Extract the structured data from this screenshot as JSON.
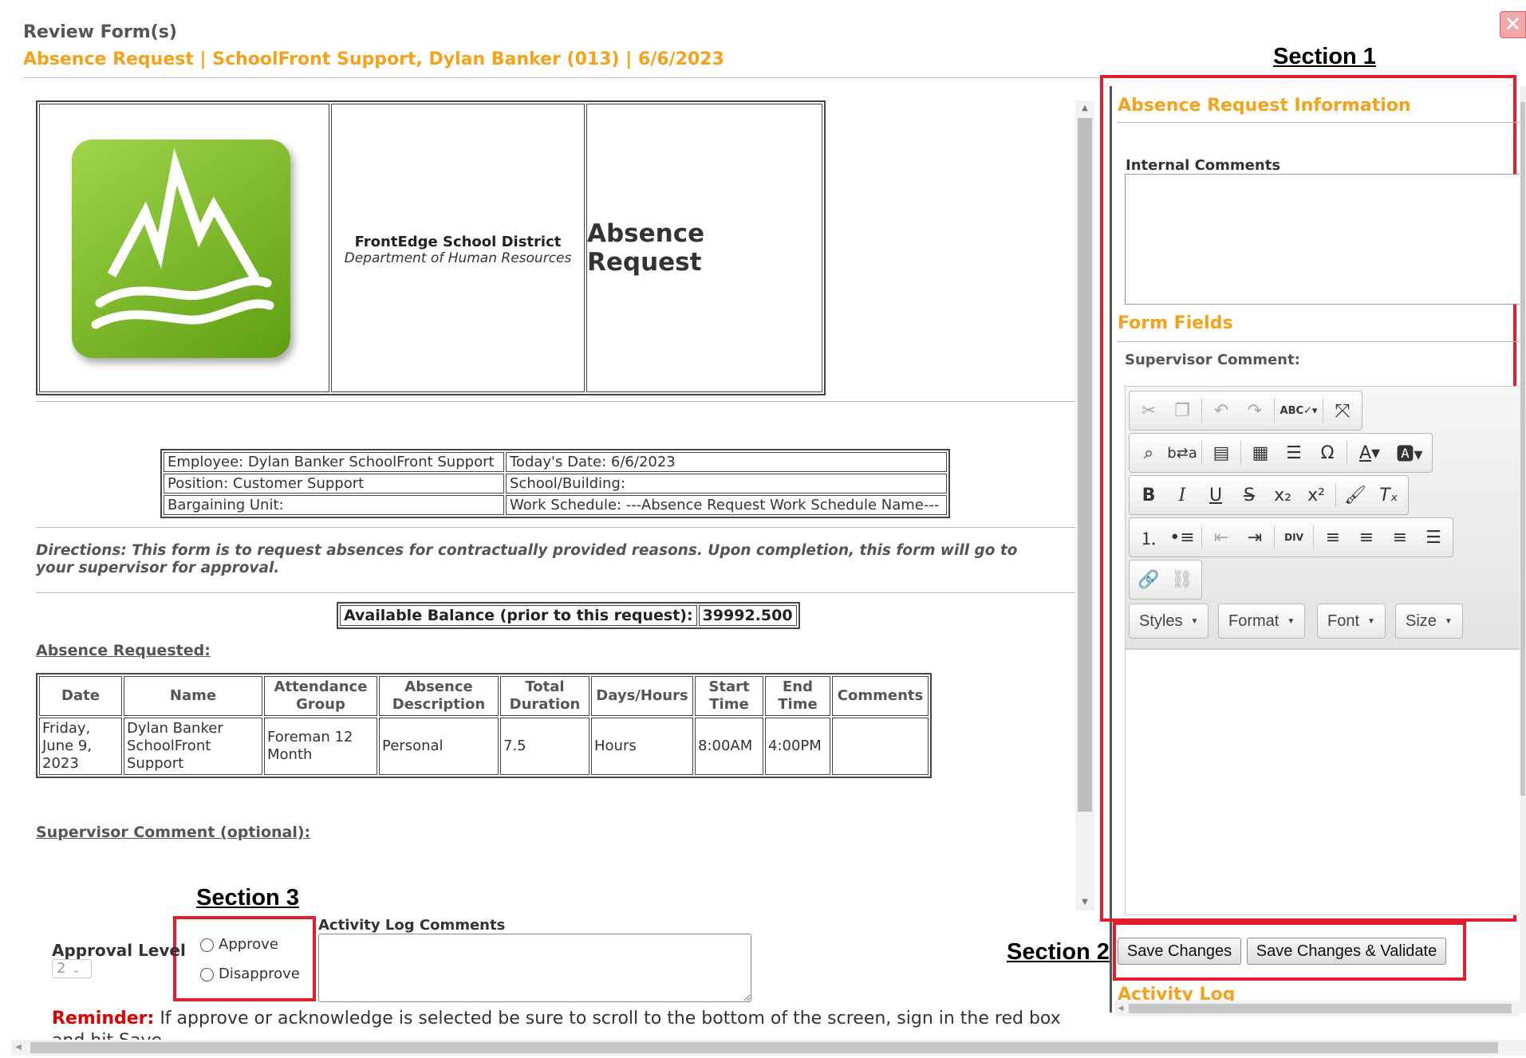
{
  "dialog": {
    "title": "Review Form(s)",
    "subtitle": "Absence Request | SchoolFront Support, Dylan Banker (013) | 6/6/2023"
  },
  "annotations": {
    "section1": "Section 1",
    "section2": "Section 2",
    "section3": "Section 3"
  },
  "form": {
    "district_name": "FrontEdge School District",
    "department": "Department of Human Resources",
    "form_title": "Absence Request",
    "info": {
      "employee": "Employee: Dylan Banker SchoolFront Support",
      "todays_date": "Today's Date: 6/6/2023",
      "position": "Position: Customer Support",
      "school": "School/Building:",
      "bargaining": "Bargaining Unit:",
      "work_schedule": "Work Schedule: ---Absence Request Work Schedule Name---"
    },
    "directions": "Directions: This form is to request absences for contractually provided reasons. Upon completion, this form will go to your supervisor for approval.",
    "balance_label": "Available Balance (prior to this request):",
    "balance_value": "39992.500",
    "absence_heading": "Absence Requested:",
    "columns": [
      "Date",
      "Name",
      "Attendance Group",
      "Absence Description",
      "Total Duration",
      "Days/Hours",
      "Start Time",
      "End Time",
      "Comments"
    ],
    "rows": [
      [
        "Friday, June 9, 2023",
        "Dylan Banker SchoolFront Support",
        "Foreman 12 Month",
        "Personal",
        "7.5",
        "Hours",
        "8:00AM",
        "4:00PM",
        ""
      ]
    ],
    "supervisor_heading": "Supervisor Comment (optional):"
  },
  "approval": {
    "level_label": "Approval Level",
    "level_value": "2",
    "approve_label": "Approve",
    "disapprove_label": "Disapprove",
    "activity_comments_label": "Activity Log Comments",
    "reminder_label": "Reminder:",
    "reminder_text": "If approve or acknowledge is selected be sure to scroll to the bottom of the screen, sign in the red box and hit Save."
  },
  "side_panel": {
    "info_heading": "Absence Request Information",
    "internal_comments_label": "Internal Comments",
    "form_fields_heading": "Form Fields",
    "supervisor_comment_label": "Supervisor Comment:",
    "editor_dropdowns": [
      "Styles",
      "Format",
      "Font",
      "Size"
    ],
    "save_label": "Save Changes",
    "save_validate_label": "Save Changes & Validate",
    "activity_log_heading": "Activity Log"
  },
  "colors": {
    "accent": "#f5a21b",
    "annotation_red": "#e31d2b",
    "reminder_red": "#e00000",
    "logo_green": "#6fb51d"
  }
}
